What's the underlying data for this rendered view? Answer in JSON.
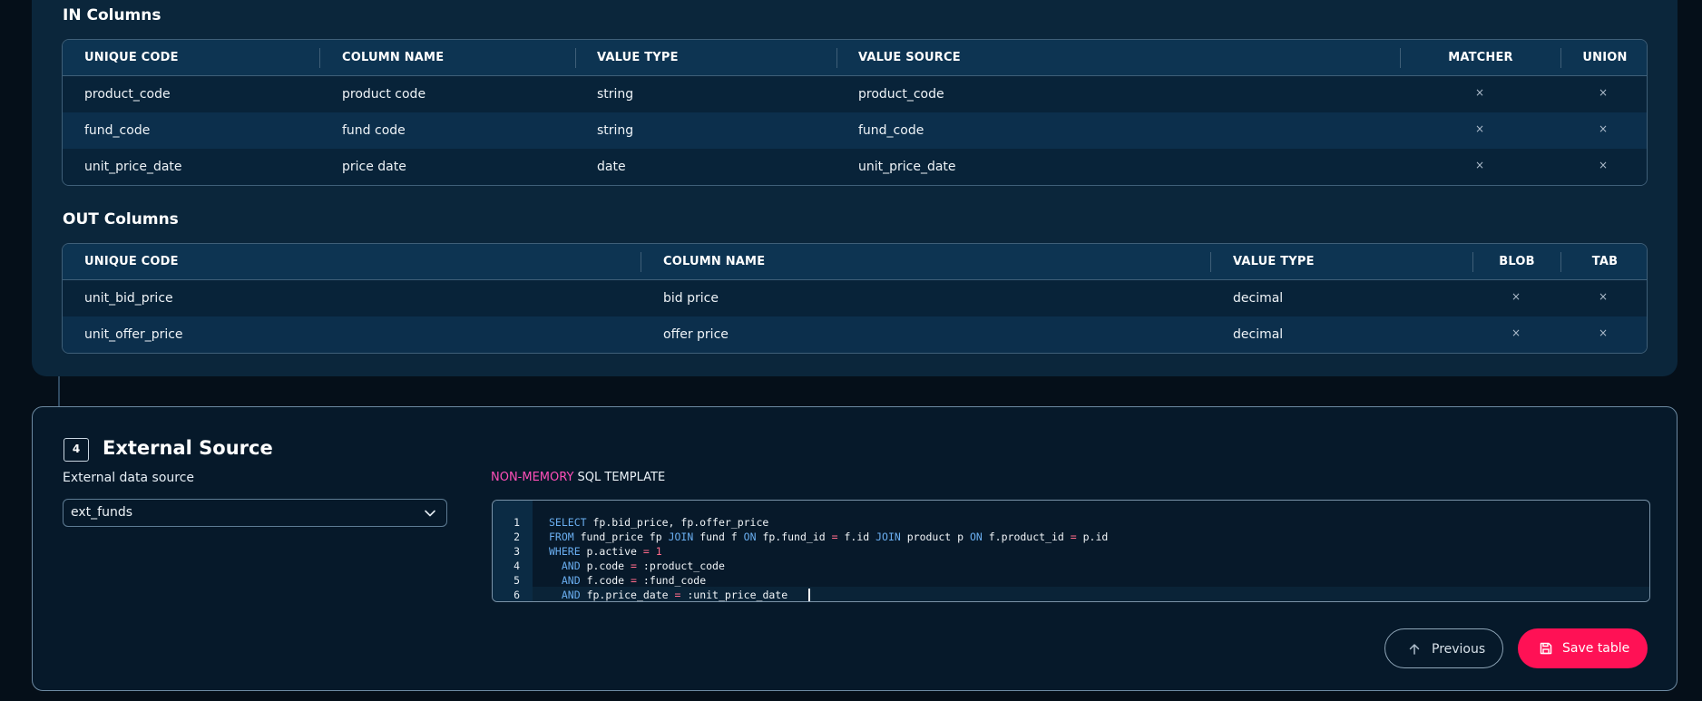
{
  "in_columns": {
    "title": "IN Columns",
    "headers": [
      "UNIQUE CODE",
      "COLUMN NAME",
      "VALUE TYPE",
      "VALUE SOURCE",
      "MATCHER",
      "UNION"
    ],
    "rows": [
      {
        "unique_code": "product_code",
        "column_name": "product code",
        "value_type": "string",
        "value_source": "product_code",
        "matcher": "×",
        "union": "×"
      },
      {
        "unique_code": "fund_code",
        "column_name": "fund code",
        "value_type": "string",
        "value_source": "fund_code",
        "matcher": "×",
        "union": "×"
      },
      {
        "unique_code": "unit_price_date",
        "column_name": "price date",
        "value_type": "date",
        "value_source": "unit_price_date",
        "matcher": "×",
        "union": "×"
      }
    ]
  },
  "out_columns": {
    "title": "OUT Columns",
    "headers": [
      "UNIQUE CODE",
      "COLUMN NAME",
      "VALUE TYPE",
      "BLOB",
      "TAB"
    ],
    "rows": [
      {
        "unique_code": "unit_bid_price",
        "column_name": "bid price",
        "value_type": "decimal",
        "blob": "×",
        "tab": "×"
      },
      {
        "unique_code": "unit_offer_price",
        "column_name": "offer price",
        "value_type": "decimal",
        "blob": "×",
        "tab": "×"
      }
    ]
  },
  "external_source": {
    "step_number": "4",
    "title": "External Source",
    "data_source_label": "External data source",
    "data_source_value": "ext_funds",
    "sql_label_highlight": "NON-MEMORY",
    "sql_label_rest": " SQL TEMPLATE",
    "sql_lines": [
      {
        "num": "1",
        "code": "SELECT fp.bid_price, fp.offer_price"
      },
      {
        "num": "2",
        "code": "FROM fund_price fp JOIN fund f ON fp.fund_id = f.id JOIN product p ON f.product_id = p.id"
      },
      {
        "num": "3",
        "code": "WHERE p.active = 1"
      },
      {
        "num": "4",
        "code": "  AND p.code = :product_code"
      },
      {
        "num": "5",
        "code": "  AND f.code = :fund_code"
      },
      {
        "num": "6",
        "code": "  AND fp.price_date = :unit_price_date"
      }
    ]
  },
  "actions": {
    "previous_label": "Previous",
    "save_label": "Save table"
  },
  "colors": {
    "accent_pink": "#ff4fb8",
    "save_button": "#ff1155",
    "sql_keyword": "#6aaef0"
  },
  "icons": {
    "previous": "arrow-up-icon",
    "save": "save-icon",
    "dropdown": "chevron-down-icon"
  }
}
